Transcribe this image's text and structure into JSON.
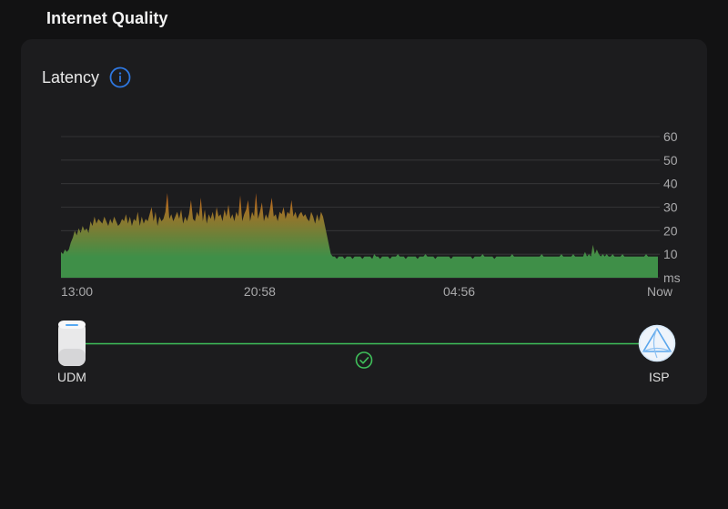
{
  "section": {
    "title": "Internet Quality"
  },
  "card": {
    "title": "Latency",
    "info_icon": "info-circle-icon"
  },
  "chart_data": {
    "type": "area",
    "title": "Latency",
    "xlabel": "",
    "ylabel": "ms",
    "ylim": [
      0,
      60
    ],
    "yticks": [
      10,
      20,
      30,
      40,
      50,
      60
    ],
    "ytick_labels": [
      "10",
      "20",
      "30",
      "40",
      "50",
      "60"
    ],
    "y_unit_label": "ms",
    "xtick_labels": [
      "13:00",
      "20:58",
      "04:56",
      "Now"
    ],
    "xtick_positions": [
      0,
      0.333,
      0.667,
      1.0
    ],
    "grid": true,
    "colors": {
      "low": "#3f8f48",
      "high": "#c4661b",
      "grid": "#3a3a3c"
    },
    "series": [
      {
        "values": [
          11,
          10,
          12,
          11,
          12,
          15,
          17,
          20,
          18,
          21,
          19,
          22,
          20,
          21,
          19,
          24,
          22,
          26,
          23,
          25,
          24,
          23,
          26,
          24,
          22,
          25,
          23,
          26,
          24,
          22,
          23,
          25,
          24,
          27,
          23,
          26,
          22,
          25,
          24,
          28,
          22,
          26,
          23,
          25,
          24,
          27,
          30,
          24,
          28,
          22,
          26,
          24,
          25,
          28,
          36,
          25,
          27,
          24,
          26,
          28,
          25,
          29,
          23,
          26,
          24,
          27,
          33,
          25,
          24,
          28,
          26,
          34,
          24,
          29,
          23,
          27,
          25,
          28,
          24,
          30,
          26,
          27,
          24,
          29,
          26,
          31,
          25,
          27,
          24,
          28,
          26,
          35,
          24,
          27,
          29,
          33,
          24,
          28,
          26,
          36,
          25,
          28,
          32,
          24,
          27,
          25,
          29,
          34,
          26,
          27,
          24,
          28,
          27,
          30,
          25,
          28,
          27,
          33,
          26,
          28,
          25,
          27,
          28,
          26,
          27,
          25,
          24,
          28,
          26,
          23,
          27,
          24,
          28,
          26,
          22,
          18,
          14,
          10,
          9,
          9,
          8,
          9,
          9,
          9,
          8,
          9,
          9,
          9,
          8,
          9,
          9,
          9,
          9,
          8,
          9,
          9,
          9,
          9,
          8,
          10,
          9,
          9,
          8,
          9,
          9,
          9,
          9,
          8,
          9,
          9,
          9,
          10,
          9,
          9,
          9,
          8,
          9,
          9,
          9,
          9,
          9,
          8,
          9,
          9,
          9,
          10,
          9,
          9,
          9,
          9,
          8,
          9,
          9,
          9,
          9,
          9,
          9,
          9,
          8,
          9,
          9,
          9,
          9,
          9,
          9,
          9,
          9,
          9,
          9,
          8,
          9,
          9,
          9,
          9,
          10,
          9,
          9,
          9,
          9,
          9,
          8,
          9,
          9,
          9,
          9,
          9,
          9,
          9,
          9,
          10,
          9,
          9,
          9,
          9,
          9,
          9,
          9,
          9,
          9,
          9,
          9,
          9,
          9,
          9,
          10,
          9,
          9,
          9,
          9,
          9,
          9,
          9,
          9,
          9,
          10,
          9,
          9,
          9,
          9,
          9,
          10,
          9,
          9,
          9,
          9,
          9,
          11,
          9,
          10,
          9,
          14,
          10,
          12,
          10,
          9,
          10,
          9,
          10,
          9,
          9,
          10,
          9,
          9,
          9,
          9,
          10,
          9,
          9,
          9,
          9,
          9,
          9,
          9,
          9,
          9,
          9,
          9,
          10,
          9,
          9,
          9,
          9,
          9,
          9
        ]
      }
    ]
  },
  "connection": {
    "left_label": "UDM",
    "right_label": "ISP",
    "status_icon": "check-circle-icon",
    "left_icon": "udm-device-icon",
    "right_icon": "isp-globe-icon",
    "line_color": "#3fbf5a"
  }
}
